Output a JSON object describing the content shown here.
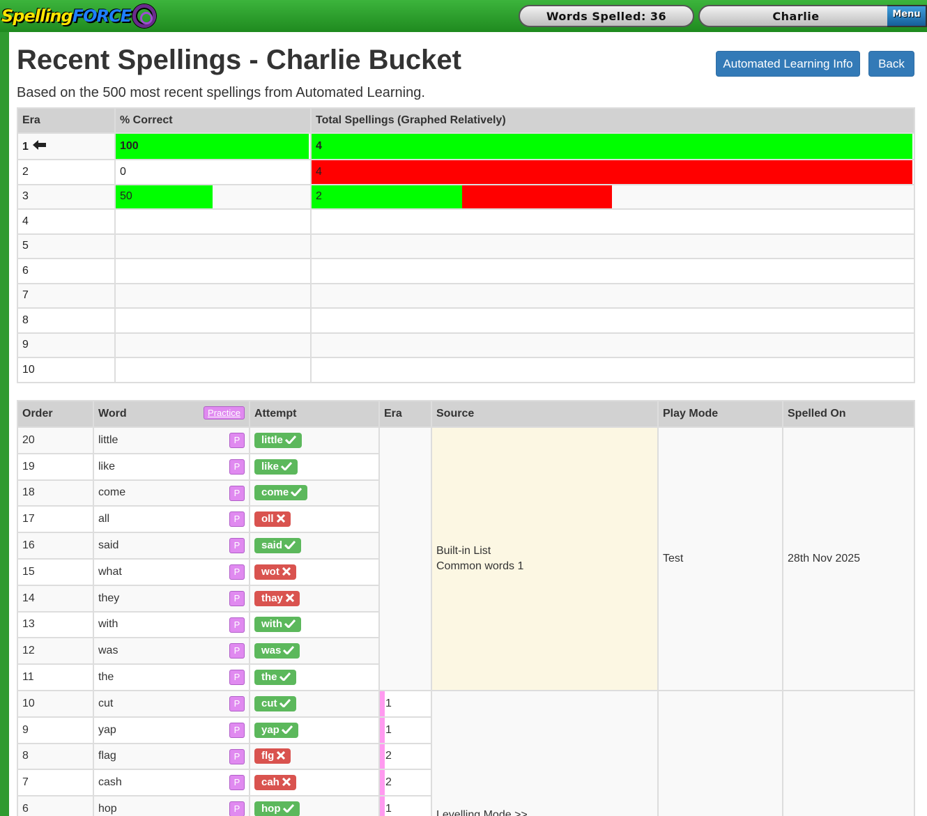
{
  "app": {
    "logo_part1": "Spelling",
    "logo_part2": "FORCE"
  },
  "topbar": {
    "words_spelled": "Words Spelled: 36",
    "user": "Charlie",
    "menu_label": "Menu"
  },
  "page": {
    "title": "Recent Spellings - Charlie Bucket",
    "subtitle": "Based on the 500 most recent spellings from Automated Learning.",
    "btn_auto": "Automated Learning Info",
    "btn_back": "Back"
  },
  "era_table": {
    "headers": [
      "Era",
      "% Correct",
      "Total Spellings (Graphed Relatively)"
    ],
    "current_arrow": "🡐",
    "rows": [
      {
        "era": "1",
        "pct": "100",
        "pct_value": 100,
        "total": "4",
        "correct_fraction": 1.0,
        "relative_total": 1.0
      },
      {
        "era": "2",
        "pct": "0",
        "pct_value": 0,
        "total": "4",
        "correct_fraction": 0.0,
        "relative_total": 1.0
      },
      {
        "era": "3",
        "pct": "50",
        "pct_value": 50,
        "total": "2",
        "correct_fraction": 0.5,
        "relative_total": 0.5
      },
      {
        "era": "4",
        "pct": "",
        "total": ""
      },
      {
        "era": "5",
        "pct": "",
        "total": ""
      },
      {
        "era": "6",
        "pct": "",
        "total": ""
      },
      {
        "era": "7",
        "pct": "",
        "total": ""
      },
      {
        "era": "8",
        "pct": "",
        "total": ""
      },
      {
        "era": "9",
        "pct": "",
        "total": ""
      },
      {
        "era": "10",
        "pct": "",
        "total": ""
      }
    ]
  },
  "spell_table": {
    "headers": {
      "order": "Order",
      "word": "Word",
      "practice": "Practice",
      "attempt": "Attempt",
      "era": "Era",
      "source": "Source",
      "mode": "Play Mode",
      "date": "Spelled On"
    },
    "p_label": "P",
    "rows": [
      {
        "order": "20",
        "word": "little",
        "attempt": "little",
        "correct": true
      },
      {
        "order": "19",
        "word": "like",
        "attempt": "like",
        "correct": true
      },
      {
        "order": "18",
        "word": "come",
        "attempt": "come",
        "correct": true
      },
      {
        "order": "17",
        "word": "all",
        "attempt": "oll",
        "correct": false
      },
      {
        "order": "16",
        "word": "said",
        "attempt": "said",
        "correct": true
      },
      {
        "order": "15",
        "word": "what",
        "attempt": "wot",
        "correct": false
      },
      {
        "order": "14",
        "word": "they",
        "attempt": "thay",
        "correct": false
      },
      {
        "order": "13",
        "word": "with",
        "attempt": "with",
        "correct": true
      },
      {
        "order": "12",
        "word": "was",
        "attempt": "was",
        "correct": true
      },
      {
        "order": "11",
        "word": "the",
        "attempt": "the",
        "correct": true
      },
      {
        "order": "10",
        "word": "cut",
        "attempt": "cut",
        "correct": true,
        "era": "1"
      },
      {
        "order": "9",
        "word": "yap",
        "attempt": "yap",
        "correct": true,
        "era": "1"
      },
      {
        "order": "8",
        "word": "flag",
        "attempt": "flg",
        "correct": false,
        "era": "2"
      },
      {
        "order": "7",
        "word": "cash",
        "attempt": "cah",
        "correct": false,
        "era": "2"
      },
      {
        "order": "6",
        "word": "hop",
        "attempt": "hop",
        "correct": true,
        "era": "1"
      }
    ],
    "group1": {
      "source_line1": "Built-in List",
      "source_line2": "Common words 1",
      "mode": "Test",
      "date": "28th Nov 2025"
    },
    "group2": {
      "source": "Levelling Mode >>"
    }
  },
  "colors": {
    "correct": "#5cb85c",
    "wrong": "#d9534f",
    "bar_green": "#00ff00",
    "bar_red": "#ff0000",
    "primary": "#337ab7"
  }
}
